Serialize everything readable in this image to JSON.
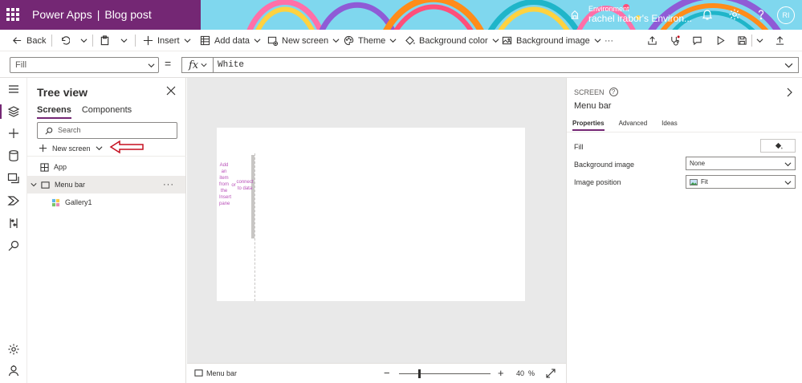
{
  "header": {
    "app": "Power Apps",
    "separator": "|",
    "doc_title": "Blog post",
    "env_label": "Environment",
    "env_value": "rachel irabor's Environ...",
    "avatar": "RI",
    "accent": "#742774"
  },
  "toolbar": {
    "back": "Back",
    "insert": "Insert",
    "add_data": "Add data",
    "new_screen": "New screen",
    "theme": "Theme",
    "background_color": "Background color",
    "background_image": "Background image",
    "more": "···"
  },
  "formula_bar": {
    "property": "Fill",
    "equals": "=",
    "fx": "fx",
    "value": "White"
  },
  "tree_view": {
    "title": "Tree view",
    "tabs": [
      "Screens",
      "Components"
    ],
    "search_placeholder": "Search",
    "new_screen": "New screen",
    "nodes": [
      {
        "label": "App"
      },
      {
        "label": "Menu bar"
      },
      {
        "label": "Gallery1"
      }
    ],
    "more": "···",
    "annotation_color": "#c50f1f"
  },
  "canvas": {
    "gallery_hint_left": [
      "Add",
      "an",
      "item",
      "from",
      "the",
      "Insert",
      "pane"
    ],
    "gallery_hint_or": "or",
    "gallery_hint_right": [
      "connect",
      "to data"
    ]
  },
  "canvas_footer": {
    "screen": "Menu bar",
    "minus": "−",
    "plus": "+",
    "zoom_value": "40",
    "zoom_unit": "%",
    "zoom_percent": 40
  },
  "properties": {
    "kind": "SCREEN",
    "help": "?",
    "name": "Menu bar",
    "tabs": [
      "Properties",
      "Advanced",
      "Ideas"
    ],
    "fill_label": "Fill",
    "bg_image_label": "Background image",
    "bg_image_value": "None",
    "img_pos_label": "Image position",
    "img_pos_value": "Fit"
  }
}
